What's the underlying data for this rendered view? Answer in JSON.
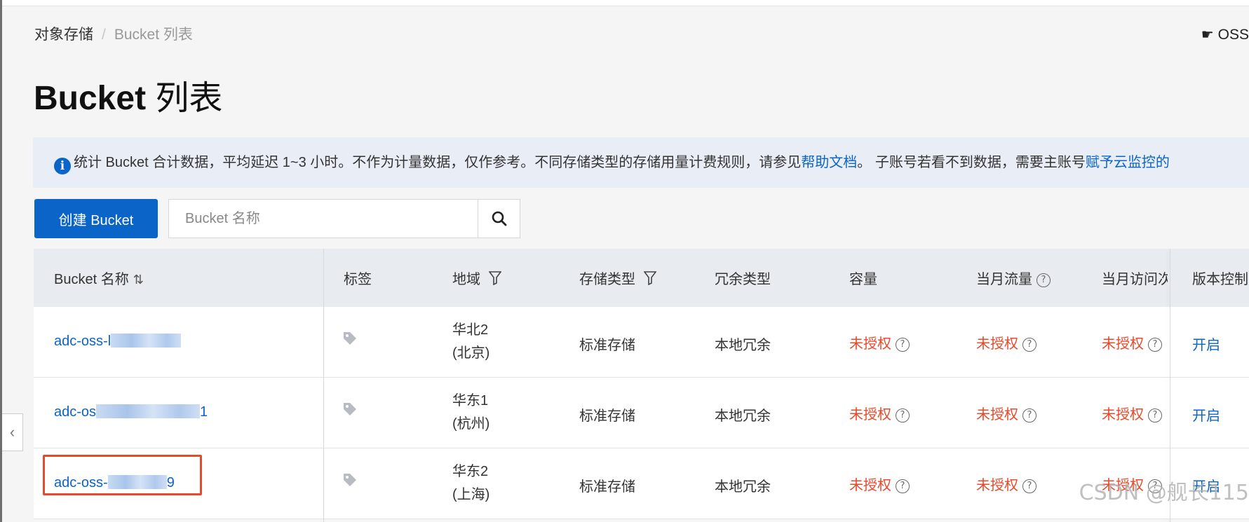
{
  "breadcrumb": {
    "root": "对象存储",
    "separator": "/",
    "current": "Bucket 列表"
  },
  "top_right": {
    "label": "OSS"
  },
  "page_title": {
    "main": "Bucket",
    "suffix": "列表"
  },
  "notice": {
    "text1": "统计 Bucket 合计数据，平均延迟 1~3 小时。不作为计量数据，仅作参考。不同存储类型的存储用量计费规则，请参见",
    "link1": "帮助文档",
    "text2": "。 子账号若看不到数据，需要主账号",
    "link2": "赋予云监控的"
  },
  "toolbar": {
    "create_label": "创建 Bucket",
    "search_placeholder": "Bucket 名称"
  },
  "table": {
    "headers": {
      "name": "Bucket 名称",
      "tag": "标签",
      "region": "地域",
      "storage_type": "存储类型",
      "redundancy": "冗余类型",
      "capacity": "容量",
      "monthly_traffic": "当月流量",
      "monthly_access": "当月访问次",
      "versioning": "版本控制"
    },
    "rows": [
      {
        "name_prefix": "adc-oss-l",
        "name_suffix": "",
        "region_line1": "华北2",
        "region_line2": "(北京)",
        "storage_type": "标准存储",
        "redundancy": "本地冗余",
        "capacity": "未授权",
        "traffic": "未授权",
        "access": "未授权",
        "versioning": "开启"
      },
      {
        "name_prefix": "adc-os",
        "name_suffix": "1",
        "region_line1": "华东1",
        "region_line2": "(杭州)",
        "storage_type": "标准存储",
        "redundancy": "本地冗余",
        "capacity": "未授权",
        "traffic": "未授权",
        "access": "未授权",
        "versioning": "开启"
      },
      {
        "name_prefix": "adc-oss-",
        "name_suffix": "9",
        "region_line1": "华东2",
        "region_line2": "(上海)",
        "storage_type": "标准存储",
        "redundancy": "本地冗余",
        "capacity": "未授权",
        "traffic": "未授权",
        "access": "未授权",
        "versioning": "开启"
      }
    ]
  },
  "watermark": "CSDN @舰长115",
  "colors": {
    "primary": "#0b64c7",
    "warning": "#e8492b",
    "notice_bg": "#e9eef6",
    "header_bg": "#e8ebef"
  }
}
